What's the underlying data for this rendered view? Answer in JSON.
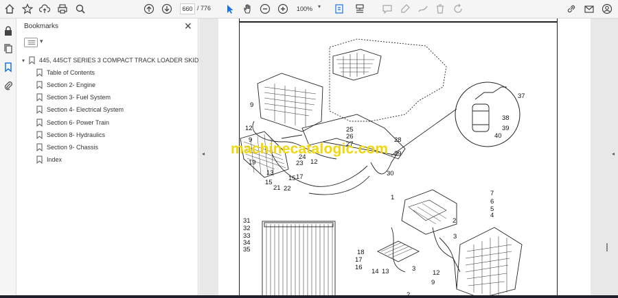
{
  "toolbar": {
    "page_current": "660",
    "page_total": "/ 776",
    "zoom": "100%",
    "icons": [
      "home-icon",
      "star-icon",
      "upload-icon",
      "print-icon",
      "search-icon",
      "page-up-icon",
      "page-down-icon",
      "select-cursor-icon",
      "hand-icon",
      "zoom-out-icon",
      "zoom-in-icon",
      "fit-page-icon",
      "scroll-mode-icon",
      "comment-icon",
      "highlight-icon",
      "draw-icon",
      "erase-icon",
      "undo-icon",
      "link-icon",
      "mail-icon",
      "account-icon"
    ]
  },
  "rail": {
    "icons": [
      "lock-icon",
      "copy-icon",
      "bookmark-icon",
      "attachment-icon"
    ],
    "active": "bookmark-icon"
  },
  "bookmarks": {
    "title": "Bookmarks",
    "root": "445, 445CT SERIES 3 COMPACT TRACK LOADER SKID STEER",
    "items": [
      "Table of Contents",
      "Section 2- Engine",
      "Section 3- Fuel System",
      "Section 4- Electrical System",
      "Section 6- Power Train",
      "Section 8- Hydraulics",
      "Section 9- Chassis",
      "Index"
    ]
  },
  "document": {
    "watermark": "machinecatalogic.com",
    "callouts_upper": [
      "9",
      "12",
      "9",
      "19",
      "13",
      "15",
      "21",
      "22",
      "15",
      "17",
      "23",
      "24",
      "12",
      "25",
      "26",
      "27",
      "28",
      "29",
      "30",
      "37",
      "38",
      "39",
      "40"
    ],
    "callouts_lower": [
      "1",
      "7",
      "6",
      "5",
      "4",
      "2",
      "3",
      "31",
      "32",
      "33",
      "34",
      "35",
      "18",
      "17",
      "16",
      "14",
      "13",
      "3",
      "12",
      "9",
      "2"
    ]
  },
  "colors": {
    "accent": "#1a73e8",
    "watermark": "#f2d70c",
    "viewer_bg": "#e8e8e8"
  }
}
